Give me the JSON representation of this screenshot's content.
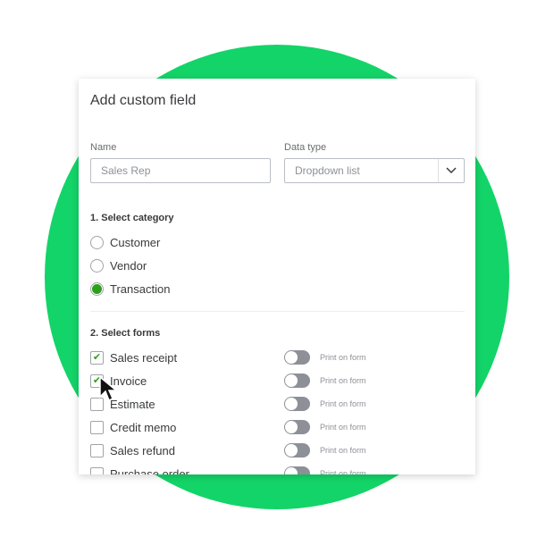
{
  "dialog": {
    "title": "Add custom field",
    "name_label": "Name",
    "name_value": "Sales Rep",
    "data_type_label": "Data type",
    "data_type_value": "Dropdown list",
    "category_heading": "1. Select category",
    "categories": [
      {
        "label": "Customer",
        "selected": false
      },
      {
        "label": "Vendor",
        "selected": false
      },
      {
        "label": "Transaction",
        "selected": true
      }
    ],
    "forms_heading": "2. Select forms",
    "forms": [
      {
        "label": "Sales receipt",
        "checked": true,
        "print_label": "Print on form",
        "print_on": false
      },
      {
        "label": "Invoice",
        "checked": true,
        "print_label": "Print on form",
        "print_on": false
      },
      {
        "label": "Estimate",
        "checked": false,
        "print_label": "Print on form",
        "print_on": false
      },
      {
        "label": "Credit memo",
        "checked": false,
        "print_label": "Print on form",
        "print_on": false
      },
      {
        "label": "Sales refund",
        "checked": false,
        "print_label": "Print on form",
        "print_on": false
      },
      {
        "label": "Purchase order",
        "checked": false,
        "print_label": "Print on form",
        "print_on": false
      }
    ]
  },
  "colors": {
    "background_circle": "#13d468",
    "accent": "#2ca01c"
  }
}
